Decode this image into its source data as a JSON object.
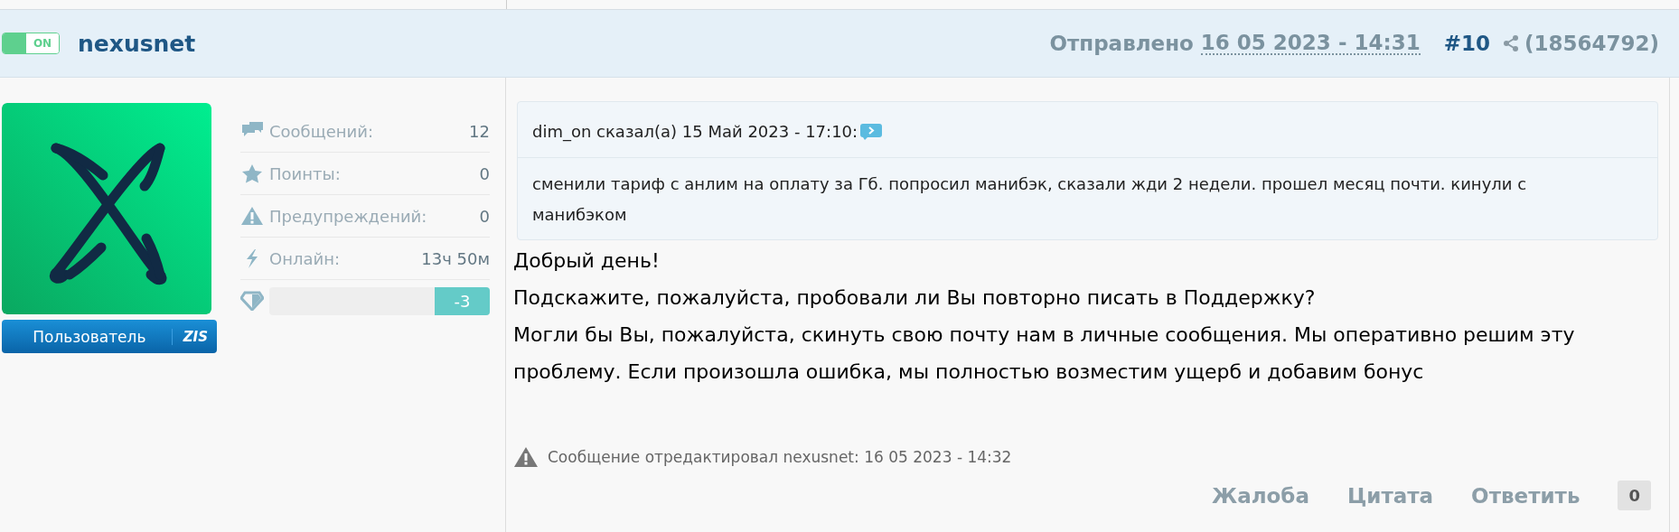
{
  "post_header": {
    "online": {
      "label": "ON"
    },
    "author": "nexusnet",
    "sent_label": "Отправлено",
    "sent_date": "16 05 2023 - 14:31",
    "post_number": "#10",
    "share_id": "(18564792)"
  },
  "profile": {
    "group": "Пользователь",
    "group_tag": "ZIS",
    "stats": [
      {
        "kind": "messages",
        "label": "Сообщений:",
        "value": "12"
      },
      {
        "kind": "points",
        "label": "Поинты:",
        "value": "0"
      },
      {
        "kind": "warnings",
        "label": "Предупреждений:",
        "value": "0"
      },
      {
        "kind": "online",
        "label": "Онлайн:",
        "value": "13ч 50м"
      }
    ],
    "reputation": {
      "level": 0.25,
      "value": "-3"
    }
  },
  "quote": {
    "header": "dim_on сказал(а) 15 Май 2023 - 17:10:",
    "text": "сменили тариф с анлим на оплату за Гб. попросил манибэк, сказали жди 2 недели. прошел месяц почти. кинули с манибэком"
  },
  "body": [
    "Добрый день!",
    "Подскажите, пожалуйста, пробовали ли Вы повторно писать в Поддержку?",
    "Могли бы Вы, пожалуйста, скинуть свою почту нам в личные сообщения. Мы оперативно решим эту проблему. Если произошла ошибка, мы полностью возместим ущерб и добавим бонус"
  ],
  "edit_note": "Сообщение отредактировал nexusnet: 16 05 2023 - 14:32",
  "actions": [
    "Жалоба",
    "Цитата",
    "Ответить"
  ],
  "like_count": "0"
}
